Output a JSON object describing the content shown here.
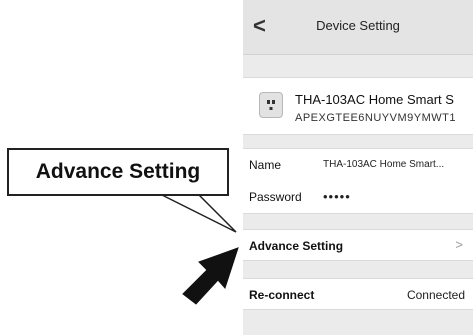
{
  "header": {
    "back_glyph": "<",
    "title": "Device Setting"
  },
  "device": {
    "icon": "smart-plug-icon",
    "name": "THA-103AC Home Smart S",
    "id": "APEXGTEE6NUYVM9YMWT1"
  },
  "form": {
    "name_label": "Name",
    "name_value": "THA-103AC Home Smart...",
    "password_label": "Password",
    "password_value": "•••••"
  },
  "advance": {
    "label": "Advance Setting",
    "chevron": ">"
  },
  "reconnect": {
    "label": "Re-connect",
    "status": "Connected"
  },
  "annotation": {
    "callout_text": "Advance Setting"
  }
}
